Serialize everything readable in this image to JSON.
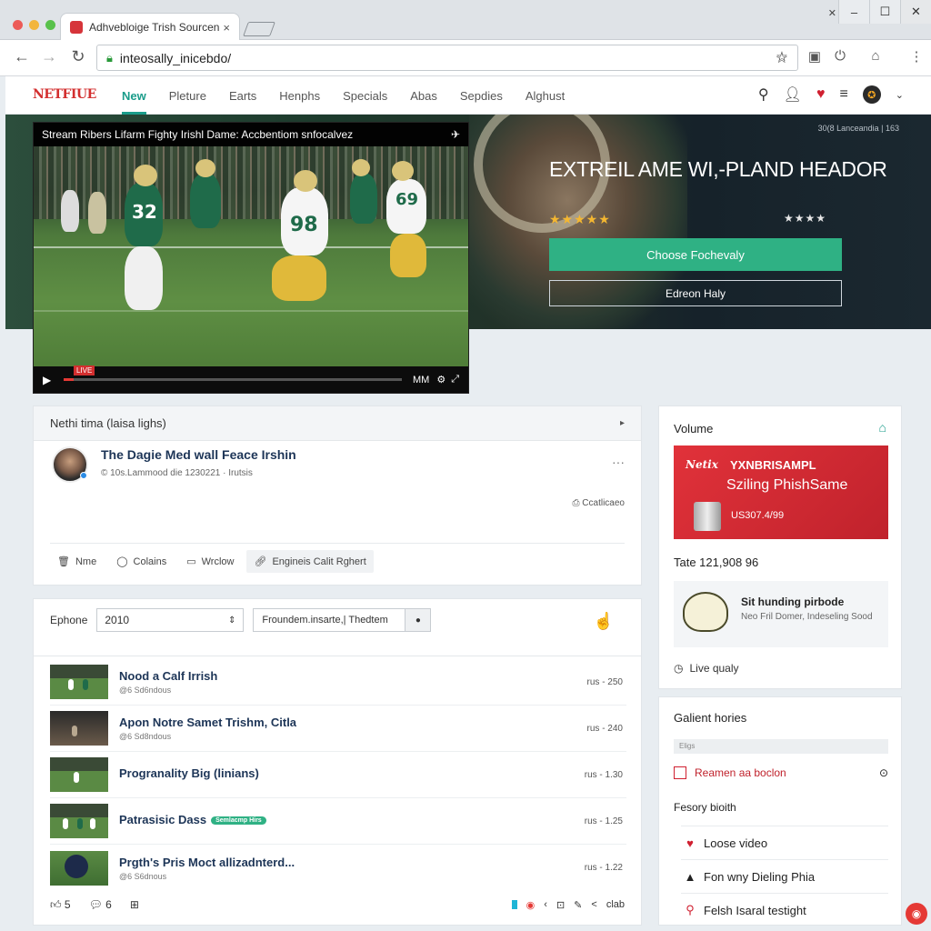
{
  "browser": {
    "tab_title": "Adhvebloige Trish Sourcen",
    "tab_close": "×",
    "address": "inteosally_inicebdo/",
    "window_controls": [
      "–",
      "☐",
      "✕"
    ],
    "pin_text": "✕"
  },
  "site": {
    "logo": "NETFIUE",
    "nav": [
      "New",
      "Pleture",
      "Earts",
      "Henphs",
      "Specials",
      "Abas",
      "Sepdies",
      "Alghust"
    ],
    "active_nav": 0
  },
  "hero": {
    "meta": "30(8 Lanceandia | 163",
    "title": "EXTREIL AME WI,-PLAND HEADOR",
    "rating_left": "★★★★★",
    "rating_right": "★★★★",
    "primary_button": "Choose Fochevaly",
    "secondary_button": "Edreon Haly"
  },
  "player": {
    "title": "Stream Ribers Lifarm Fighty Irishl Dame: Accbentiom snfocalvez",
    "time": "MM",
    "progress": 0.03,
    "live_tag": "LIVE",
    "jersey_numbers": [
      "32",
      "98",
      "69"
    ]
  },
  "post_card": {
    "header": "Nethi tima (laisa lighs)",
    "header_icon": "▸",
    "title": "The Dagie Med wall Feace Irshin",
    "subtitle": "© 10s.Lammood die 1230221 · Irutsis",
    "attachment": "Ccatlicaeo",
    "actions": [
      {
        "icon": "trash-icon",
        "label": "Nme"
      },
      {
        "icon": "comment-icon",
        "label": "Colains"
      },
      {
        "icon": "window-icon",
        "label": "Wrclow"
      },
      {
        "icon": "link-icon",
        "label": "Engineis Calit Rghert"
      }
    ]
  },
  "list_card": {
    "filter_label": "Ephone",
    "select_value": "2010",
    "search_value": "Froundem.insarte,| Thedtem",
    "items": [
      {
        "title": "Nood a Calf Irrish",
        "sub": "@6 Sd6ndous",
        "meta": "rus - 250",
        "badge": ""
      },
      {
        "title": "Apon Notre Samet Trishm, Citla",
        "sub": "@6 Sd8ndous",
        "meta": "rus - 240",
        "badge": ""
      },
      {
        "title": "Progranality Big (linians)",
        "sub": "",
        "meta": "rus - 1.30",
        "badge": ""
      },
      {
        "title": "Patrasisic Dass",
        "sub": "",
        "meta": "rus - 1.25",
        "badge": "Semlacmp Hirs"
      },
      {
        "title": "Prgth's Pris Moct allizadnterd...",
        "sub": "@6 S6dnous",
        "meta": "rus - 1.22",
        "badge": ""
      }
    ],
    "footer_left": [
      "5",
      "6",
      ""
    ],
    "footer_right": "clab"
  },
  "volume_card": {
    "title": "Volume",
    "promo_logo": "Netix",
    "promo_line1": "YXNBRISAMPL",
    "promo_line2": "Sziling PhishSame",
    "promo_price": "US307.4/99",
    "total": "Tate 121,908 96",
    "mini_title": "Sit hunding pirbode",
    "mini_sub": "Neo Fril Domer, Indeseling Sood",
    "live_quality": "Live qualy"
  },
  "holidays_card": {
    "title": "Galient hories",
    "bar_text": "Eligs",
    "reminder": "Reamen aa boclon",
    "section": "Fesory bioith",
    "items": [
      {
        "icon": "heart-icon",
        "label": "Loose video"
      },
      {
        "icon": "warning-icon",
        "label": "Fon wny Dieling Phia"
      },
      {
        "icon": "pin-icon",
        "label": "Felsh Isaral testight"
      }
    ]
  },
  "colors": {
    "accent": "#1a9c8a",
    "primary_button": "#2fb184",
    "brand_red": "#d32f2f",
    "promo_red": "#e1323a"
  }
}
